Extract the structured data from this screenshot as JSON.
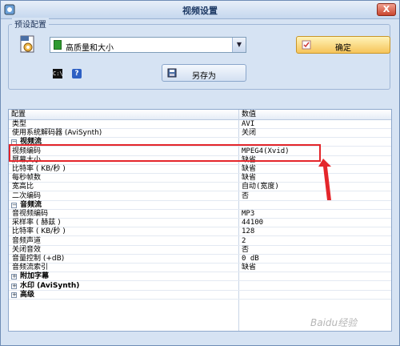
{
  "window": {
    "title": "视频设置",
    "close_label": "X"
  },
  "preset": {
    "legend": "预设配置",
    "selected": "高质量和大小",
    "ok_label": "确定",
    "save_as_label": "另存为"
  },
  "grid": {
    "col_config": "配置",
    "col_value": "数值",
    "rows": [
      {
        "name": "类型",
        "value": "AVI"
      },
      {
        "name": "使用系统解码器 (AviSynth)",
        "value": "关闭"
      },
      {
        "name": "视频流",
        "value": "",
        "section": true,
        "toggle": "−"
      },
      {
        "name": "视频编码",
        "value": "MPEG4(Xvid)"
      },
      {
        "name": "屏幕大小",
        "value": "缺省"
      },
      {
        "name": "比特率 ( KB/秒 )",
        "value": "缺省"
      },
      {
        "name": "每秒帧数",
        "value": "缺省"
      },
      {
        "name": "宽高比",
        "value": "自动(宽度)"
      },
      {
        "name": "二次编码",
        "value": "否"
      },
      {
        "name": "音频流",
        "value": "",
        "section": true,
        "toggle": "−"
      },
      {
        "name": "音视频编码",
        "value": "MP3"
      },
      {
        "name": "采样率 ( 赫兹 )",
        "value": "44100"
      },
      {
        "name": "比特率 ( KB/秒 )",
        "value": "128"
      },
      {
        "name": "音频声道",
        "value": "2"
      },
      {
        "name": "关闭音效",
        "value": "否"
      },
      {
        "name": "音量控制 (+dB)",
        "value": "0 dB"
      },
      {
        "name": "音频流索引",
        "value": "缺省"
      },
      {
        "name": "附加字幕",
        "value": "",
        "section": true,
        "toggle": "+"
      },
      {
        "name": "水印 (AviSynth)",
        "value": "",
        "section": true,
        "toggle": "+"
      },
      {
        "name": "高级",
        "value": "",
        "section": true,
        "toggle": "+"
      }
    ]
  },
  "watermark": "Baidu经验",
  "colors": {
    "highlight": "#e4262b",
    "ok_button": "#f6c45a"
  }
}
